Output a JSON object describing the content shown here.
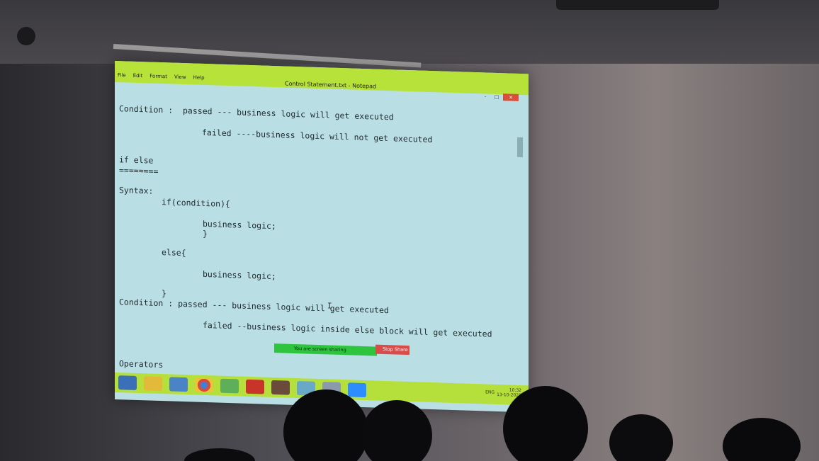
{
  "window": {
    "title": "Control Statement.txt - Notepad",
    "menu": [
      "File",
      "Edit",
      "Format",
      "View",
      "Help"
    ],
    "buttons": {
      "minimize": "-",
      "maximize": "□",
      "close": "×"
    }
  },
  "editor": {
    "lines": [
      "Condition :  passed --- business logic will get executed",
      "failed ----business logic will not get executed",
      "if else",
      "========",
      "Syntax:",
      "if(condition){",
      "business logic;",
      "}",
      "else{",
      "business logic;",
      "}",
      "Condition : passed --- business logic will get executed",
      "failed --business logic inside else block will get executed",
      "Operators"
    ]
  },
  "screen_share": {
    "status": "You are screen sharing",
    "stop_label": "Stop Share"
  },
  "taskbar": {
    "language": "ENG",
    "time": "10:32",
    "date": "13-10-2021",
    "icons": [
      "windows-start-icon",
      "file-explorer-icon",
      "store-icon",
      "chrome-icon",
      "maps-icon",
      "acrobat-icon",
      "settings-icon",
      "paint-icon",
      "snipping-icon",
      "zoom-icon"
    ]
  },
  "colors": {
    "editor_bg": "#b9dfe4",
    "titlebar": "#b6e23a",
    "share_green": "#2ec43e",
    "stop_red": "#d94a4a"
  }
}
